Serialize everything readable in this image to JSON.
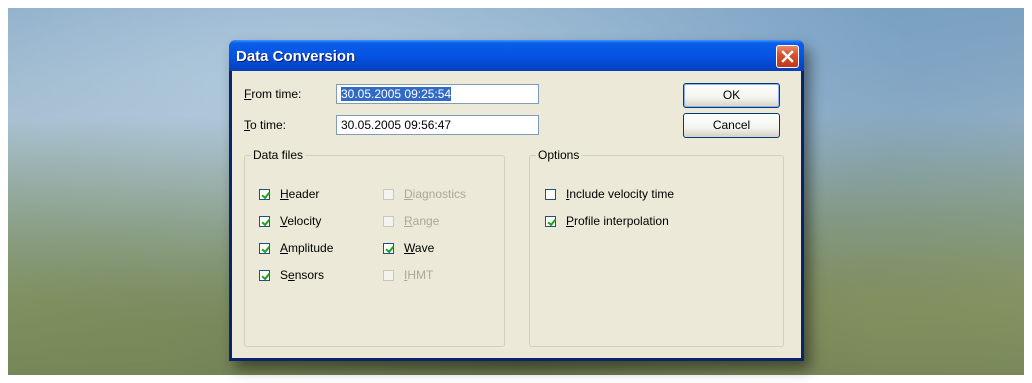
{
  "dialog": {
    "title": "Data Conversion",
    "close_icon": "close-icon"
  },
  "from_time": {
    "label_accel": "F",
    "label_rest": "rom time:",
    "value": "30.05.2005 09:25:54"
  },
  "to_time": {
    "label_accel": "T",
    "label_rest": "o time:",
    "value": "30.05.2005 09:56:47"
  },
  "buttons": {
    "ok": "OK",
    "cancel": "Cancel"
  },
  "data_files": {
    "title": "Data files",
    "items": [
      {
        "accel": "H",
        "rest": "eader",
        "checked": true,
        "enabled": true
      },
      {
        "accel": "V",
        "rest": "elocity",
        "checked": true,
        "enabled": true
      },
      {
        "accel": "A",
        "rest": "mplitude",
        "checked": true,
        "enabled": true
      },
      {
        "accel": "S",
        "rest": "ensors",
        "checked": true,
        "enabled": true,
        "prefix": "S",
        "accel_mid": "e",
        "rest_mid": "nsors"
      },
      {
        "accel": "D",
        "rest": "iagnostics",
        "checked": false,
        "enabled": false
      },
      {
        "accel": "R",
        "rest": "ange",
        "checked": false,
        "enabled": false
      },
      {
        "accel": "W",
        "rest": "ave",
        "checked": true,
        "enabled": true
      },
      {
        "accel": "I",
        "rest": "HMT",
        "checked": false,
        "enabled": false
      }
    ]
  },
  "options": {
    "title": "Options",
    "items": [
      {
        "accel": "I",
        "rest": "nclude velocity time",
        "checked": false
      },
      {
        "accel": "P",
        "rest": "rofile interpolation",
        "checked": true
      }
    ]
  }
}
